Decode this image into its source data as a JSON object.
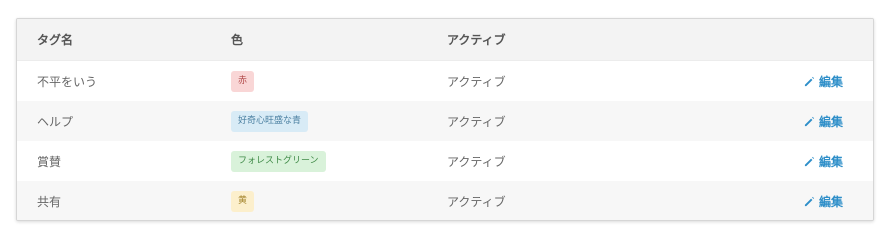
{
  "table": {
    "headers": {
      "name": "タグ名",
      "color": "色",
      "status": "アクティブ"
    },
    "rows": [
      {
        "name": "不平をいう",
        "color_label": "赤",
        "color_bg": "#f9d6d6",
        "color_fg": "#b04848",
        "status": "アクティブ",
        "action": "編集"
      },
      {
        "name": "ヘルプ",
        "color_label": "好奇心旺盛な青",
        "color_bg": "#d8ebf6",
        "color_fg": "#4a7fa0",
        "status": "アクティブ",
        "action": "編集"
      },
      {
        "name": "賞賛",
        "color_label": "フォレストグリーン",
        "color_bg": "#d9f2da",
        "color_fg": "#3f8a47",
        "status": "アクティブ",
        "action": "編集"
      },
      {
        "name": "共有",
        "color_label": "黄",
        "color_bg": "#fcefcc",
        "color_fg": "#a5862e",
        "status": "アクティブ",
        "action": "編集"
      }
    ]
  },
  "icons": {
    "edit": "pencil-icon"
  },
  "colors": {
    "link": "#2f8fc9",
    "header_bg": "#f3f3f3",
    "alt_row_bg": "#f7f7f7"
  }
}
